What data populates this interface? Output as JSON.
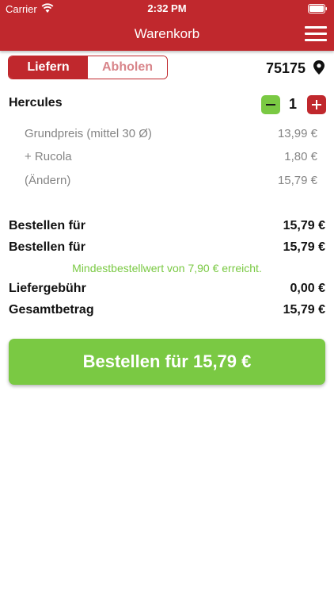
{
  "status": {
    "carrier": "Carrier",
    "time": "2:32 PM"
  },
  "header": {
    "title": "Warenkorb"
  },
  "delivery": {
    "tabs": [
      "Liefern",
      "Abholen"
    ],
    "active": "Liefern",
    "postcode": "75175"
  },
  "item": {
    "name": "Hercules",
    "quantity": "1",
    "lines": [
      {
        "label": "Grundpreis (mittel 30 Ø)",
        "value": "13,99 €"
      },
      {
        "label": "+ Rucola",
        "value": "1,80 €"
      },
      {
        "label": "(Ändern)",
        "value": "15,79 €"
      }
    ]
  },
  "summary": {
    "rows": [
      {
        "label": "Bestellen für",
        "value": "15,79 €"
      },
      {
        "label": "Bestellen für",
        "value": "15,79 €"
      }
    ],
    "notice": "Mindestbestellwert von 7,90 € erreicht.",
    "fee_label": "Liefergebühr",
    "fee_value": "0,00 €",
    "total_label": "Gesamtbetrag",
    "total_value": "15,79 €"
  },
  "order_button": "Bestellen für 15,79 €",
  "colors": {
    "brand_red": "#c0282d",
    "accent_green": "#7ac943"
  }
}
